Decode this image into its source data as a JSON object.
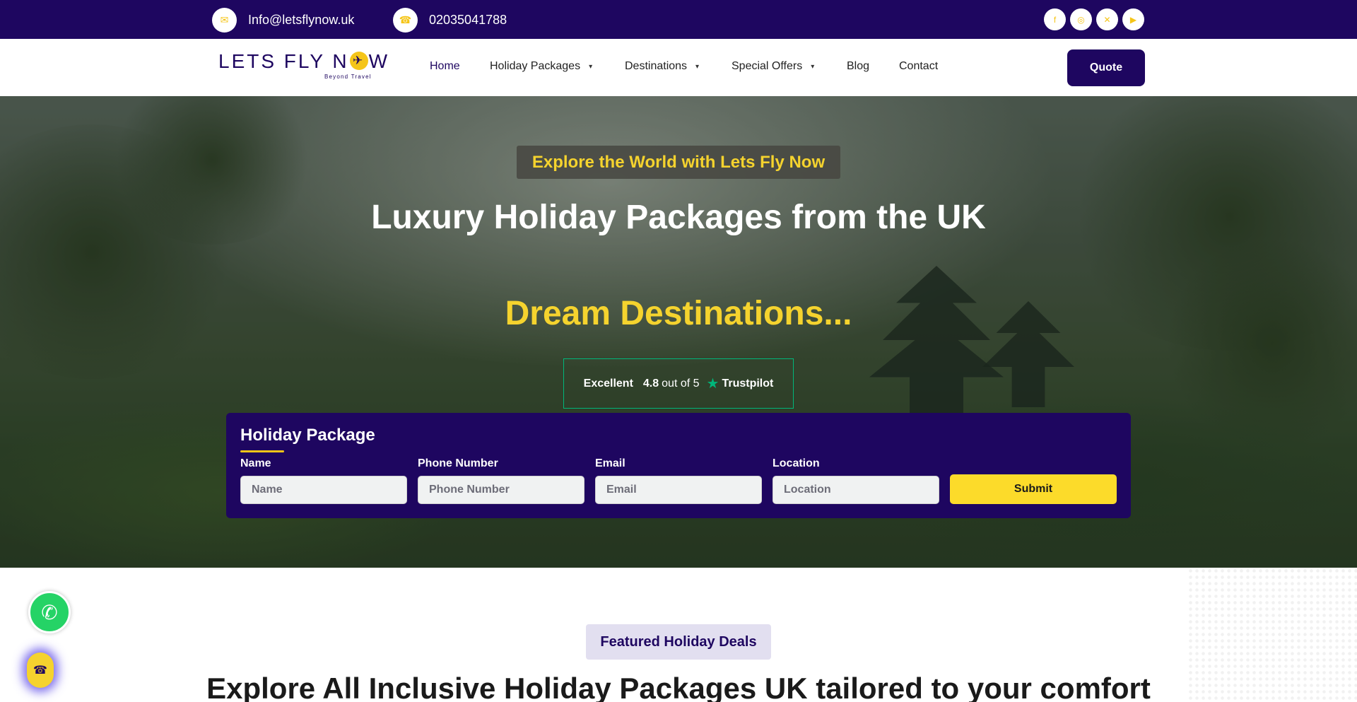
{
  "colors": {
    "brand_navy": "#1e0660",
    "accent_yellow": "#f5d32e",
    "trustpilot_green": "#00b67a"
  },
  "topbar": {
    "email": "Info@letsflynow.uk",
    "email_icon": "envelope-icon",
    "phone": "02035041788",
    "phone_icon": "phone-icon",
    "social_icons": [
      "facebook-icon",
      "instagram-icon",
      "twitter-icon",
      "youtube-icon"
    ]
  },
  "nav": {
    "logo_text": "LETS FLY N",
    "logo_text_end": "W",
    "logo_tagline": "Beyond Travel",
    "items": [
      {
        "label": "Home",
        "has_dropdown": false,
        "active": true
      },
      {
        "label": "Holiday Packages",
        "has_dropdown": true
      },
      {
        "label": "Destinations",
        "has_dropdown": true
      },
      {
        "label": "Special Offers",
        "has_dropdown": true
      },
      {
        "label": "Blog",
        "has_dropdown": false
      },
      {
        "label": "Contact",
        "has_dropdown": false
      }
    ],
    "quote_label": "Quote"
  },
  "hero": {
    "eyebrow": "Explore the World with Lets Fly Now",
    "title": "Luxury Holiday Packages from the UK",
    "subtitle": "Dream Destinations...",
    "trustpilot": {
      "label": "Excellent",
      "score": "4.8",
      "out_of": "out of 5",
      "brand": "Trustpilot"
    }
  },
  "form": {
    "title": "Holiday Package",
    "fields": [
      {
        "label": "Name",
        "placeholder": "Name",
        "value": ""
      },
      {
        "label": "Phone Number",
        "placeholder": "Phone Number",
        "value": ""
      },
      {
        "label": "Email",
        "placeholder": "Email",
        "value": ""
      },
      {
        "label": "Location",
        "placeholder": "Location",
        "value": ""
      }
    ],
    "submit_label": "Submit"
  },
  "featured": {
    "pill": "Featured Holiday Deals",
    "heading": "Explore All Inclusive Holiday Packages UK tailored to your comfort"
  },
  "floating": {
    "whatsapp_icon": "whatsapp-icon",
    "call_icon": "phone-icon"
  }
}
